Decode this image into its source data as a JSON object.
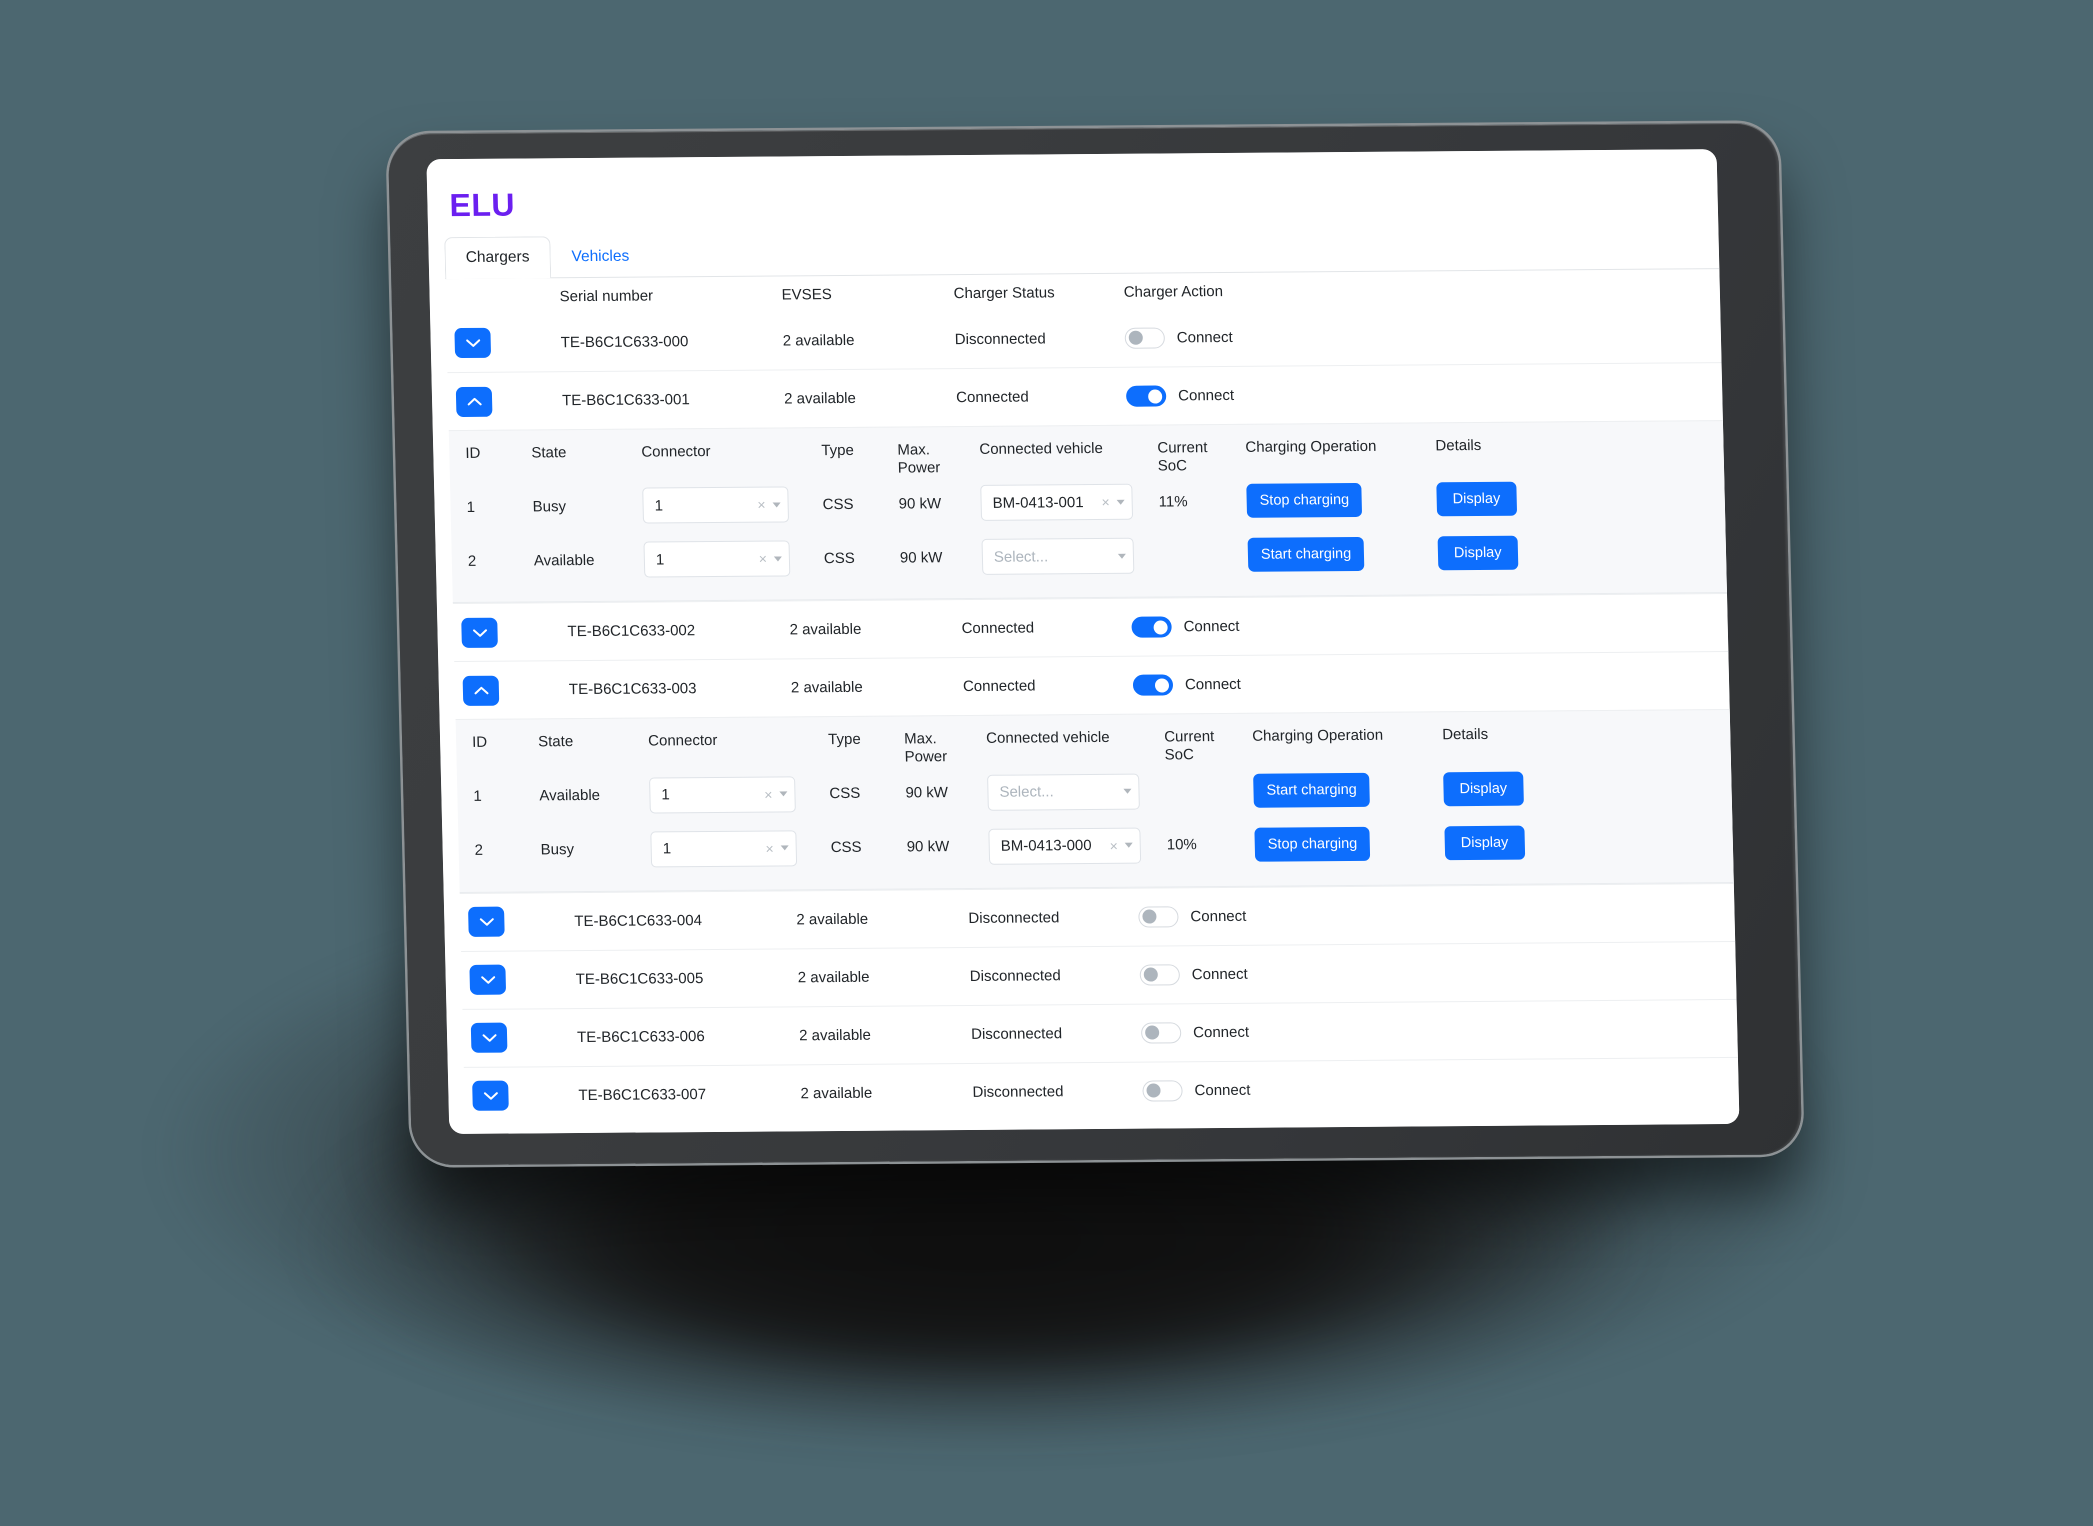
{
  "brand": {
    "name": "ELU",
    "color": "#6b1ff0"
  },
  "theme": {
    "background": "#4c6770",
    "accent": "#0d6efd",
    "panel": "#f7f8fa"
  },
  "tabs": [
    {
      "label": "Chargers",
      "active": true
    },
    {
      "label": "Vehicles",
      "active": false
    }
  ],
  "table": {
    "headers": {
      "serial": "Serial number",
      "evses": "EVSES",
      "status": "Charger Status",
      "action": "Charger Action"
    },
    "action_label": "Connect"
  },
  "evse_table": {
    "headers": {
      "id": "ID",
      "state": "State",
      "connector": "Connector",
      "type": "Type",
      "max_power_line1": "Max.",
      "max_power_line2": "Power",
      "vehicle": "Connected vehicle",
      "soc_line1": "Current",
      "soc_line2": "SoC",
      "operation": "Charging Operation",
      "details": "Details"
    },
    "placeholder_select": "Select...",
    "details_button": "Display",
    "start_label": "Start charging",
    "stop_label": "Stop charging"
  },
  "chargers": [
    {
      "serial": "TE-B6C1C633-000",
      "evses": "2 available",
      "status": "Disconnected",
      "connected": false,
      "expanded": false
    },
    {
      "serial": "TE-B6C1C633-001",
      "evses": "2 available",
      "status": "Connected",
      "connected": true,
      "expanded": true,
      "evses_rows": [
        {
          "id": "1",
          "state": "Busy",
          "connector": "1",
          "type": "CSS",
          "max_power": "90 kW",
          "vehicle": "BM-0413-001",
          "vehicle_selected": true,
          "soc": "11%",
          "operation": "Stop charging",
          "details": "Display"
        },
        {
          "id": "2",
          "state": "Available",
          "connector": "1",
          "type": "CSS",
          "max_power": "90 kW",
          "vehicle": "Select...",
          "vehicle_selected": false,
          "soc": "",
          "operation": "Start charging",
          "details": "Display"
        }
      ]
    },
    {
      "serial": "TE-B6C1C633-002",
      "evses": "2 available",
      "status": "Connected",
      "connected": true,
      "expanded": false
    },
    {
      "serial": "TE-B6C1C633-003",
      "evses": "2 available",
      "status": "Connected",
      "connected": true,
      "expanded": true,
      "evses_rows": [
        {
          "id": "1",
          "state": "Available",
          "connector": "1",
          "type": "CSS",
          "max_power": "90 kW",
          "vehicle": "Select...",
          "vehicle_selected": false,
          "soc": "",
          "operation": "Start charging",
          "details": "Display"
        },
        {
          "id": "2",
          "state": "Busy",
          "connector": "1",
          "type": "CSS",
          "max_power": "90 kW",
          "vehicle": "BM-0413-000",
          "vehicle_selected": true,
          "soc": "10%",
          "operation": "Stop charging",
          "details": "Display"
        }
      ]
    },
    {
      "serial": "TE-B6C1C633-004",
      "evses": "2 available",
      "status": "Disconnected",
      "connected": false,
      "expanded": false
    },
    {
      "serial": "TE-B6C1C633-005",
      "evses": "2 available",
      "status": "Disconnected",
      "connected": false,
      "expanded": false
    },
    {
      "serial": "TE-B6C1C633-006",
      "evses": "2 available",
      "status": "Disconnected",
      "connected": false,
      "expanded": false
    },
    {
      "serial": "TE-B6C1C633-007",
      "evses": "2 available",
      "status": "Disconnected",
      "connected": false,
      "expanded": false
    }
  ]
}
